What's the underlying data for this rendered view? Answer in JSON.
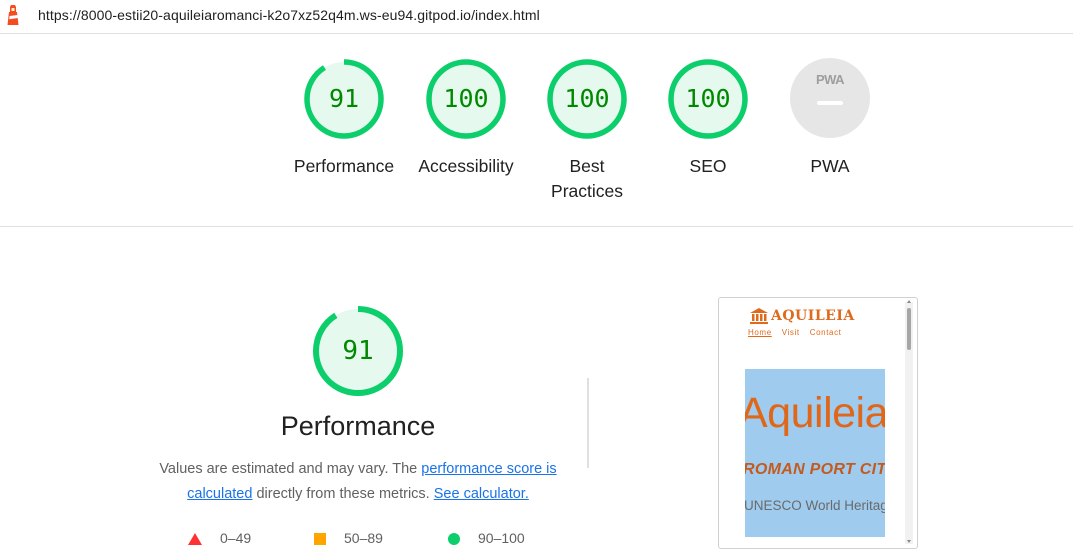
{
  "header": {
    "url": "https://8000-estii20-aquileiaromanci-k2o7xz52q4m.ws-eu94.gitpod.io/index.html"
  },
  "summary": [
    {
      "label": "Performance",
      "score": "91",
      "value": 91
    },
    {
      "label": "Accessibility",
      "score": "100",
      "value": 100
    },
    {
      "label": "Best Practices",
      "score": "100",
      "value": 100
    },
    {
      "label": "SEO",
      "score": "100",
      "value": 100
    },
    {
      "label": "PWA",
      "badge": "PWA"
    }
  ],
  "performance": {
    "score": "91",
    "value": 91,
    "title": "Performance",
    "desc_prefix": "Values are estimated and may vary. The ",
    "link1": "performance score is calculated",
    "desc_middle": " directly from these metrics. ",
    "link2": "See calculator."
  },
  "legend": [
    {
      "range": "0–49",
      "shape": "triangle",
      "color": "#ff3333"
    },
    {
      "range": "50–89",
      "shape": "square",
      "color": "#ffa400"
    },
    {
      "range": "90–100",
      "shape": "circle",
      "color": "#0cce6b"
    }
  ],
  "preview": {
    "site_title": "AQUILEIA",
    "nav": [
      "Home",
      "Visit",
      "Contact"
    ],
    "hero_title": "Aquileia",
    "hero_subtitle": "ROMAN PORT CITY",
    "hero_tagline": "UNESCO World Heritage"
  },
  "colors": {
    "pass": "#0cce6b",
    "pass_text": "#008800",
    "pass_fill": "#e5f9ee",
    "accent_orange": "#e06a1c"
  }
}
